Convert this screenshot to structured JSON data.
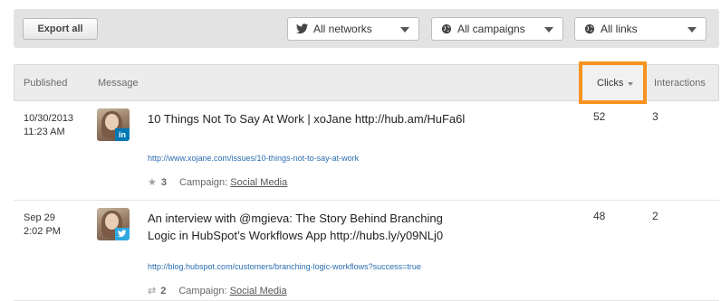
{
  "toolbar": {
    "export_label": "Export all",
    "networks": {
      "icon": "twitter-bird-icon",
      "label": "All networks"
    },
    "campaigns": {
      "icon": "globe-icon",
      "label": "All campaigns"
    },
    "links": {
      "icon": "globe-icon",
      "label": "All links"
    }
  },
  "table": {
    "columns": {
      "published": "Published",
      "message": "Message",
      "clicks": "Clicks",
      "interactions": "Interactions"
    },
    "rows": [
      {
        "date": "10/30/2013",
        "time": "11:23 AM",
        "network": "linkedin",
        "network_badge": "in",
        "message": "10 Things Not To Say At Work | xoJane http://hub.am/HuFa6l",
        "url": "http://www.xojane.com/issues/10-things-not-to-say-at-work",
        "meta_icon": "star-icon",
        "meta_count": "3",
        "campaign_label": "Campaign:",
        "campaign": "Social Media",
        "clicks": "52",
        "interactions": "3"
      },
      {
        "date": "Sep 29",
        "time": "2:02 PM",
        "network": "twitter",
        "network_badge": "t",
        "message": "An interview with @mgieva: The Story Behind Branching Logic in HubSpot’s Workflows App http://hubs.ly/y09NLj0",
        "url": "http://blog.hubspot.com/customers/branching-logic-workflows?success=true",
        "meta_icon": "retweet-icon",
        "meta_count": "2",
        "campaign_label": "Campaign:",
        "campaign": "Social Media",
        "clicks": "48",
        "interactions": "2"
      }
    ]
  },
  "colors": {
    "highlight": "#f7931e",
    "link": "#2a6db0",
    "linkedin": "#0077b5",
    "twitter": "#2fa8e0"
  }
}
